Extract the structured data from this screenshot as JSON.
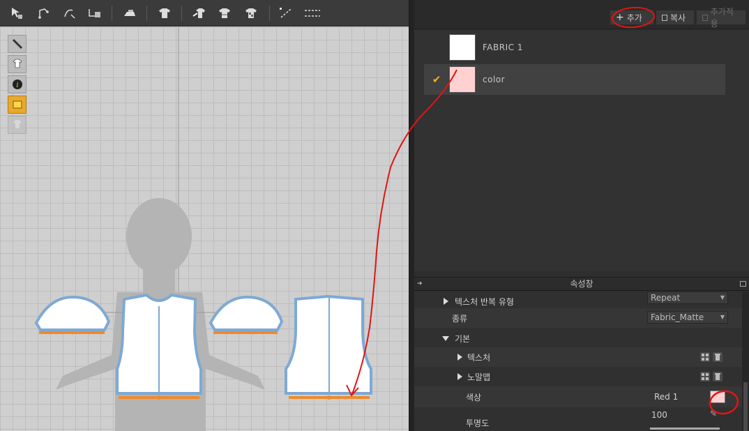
{
  "fabric_toolbar": {
    "add_label": "추가",
    "copy_label": "복사",
    "apply_label": "추가적용"
  },
  "fabric_list": [
    {
      "name": "FABRIC 1",
      "swatch_color": "#ffffff",
      "selected": false
    },
    {
      "name": "color",
      "swatch_color": "#ffd1d1",
      "selected": true
    }
  ],
  "property_panel": {
    "title": "속성창",
    "rows": {
      "texture_repeat_label": "텍스처 반복 유형",
      "texture_repeat_value": "Repeat",
      "type_label": "종류",
      "type_value": "Fabric_Matte",
      "basic_label": "기본",
      "texture_label": "텍스처",
      "normal_map_label": "노말맵",
      "color_label": "색상",
      "color_value": "Red 1",
      "color_swatch": "#ffd1d1",
      "opacity_label": "투명도",
      "opacity_value": "100"
    }
  },
  "colors": {
    "accent_check": "#f0b418",
    "annotation_red": "#e01515",
    "piece_outline": "#7ea9d4",
    "piece_hem": "#f08a2a"
  },
  "icons": [
    "select-icon",
    "edit-point-icon",
    "curve-icon",
    "sew-icon",
    "iron-icon",
    "shirt-icon",
    "tack-icon",
    "fold-icon",
    "grade-icon",
    "line-icon",
    "measure-icon",
    "visibility-icon",
    "info-icon",
    "texture-icon",
    "lock-icon",
    "plus-icon",
    "copy-icon",
    "apply-icon",
    "checkerboard-icon",
    "trash-icon",
    "eyedropper-icon"
  ]
}
